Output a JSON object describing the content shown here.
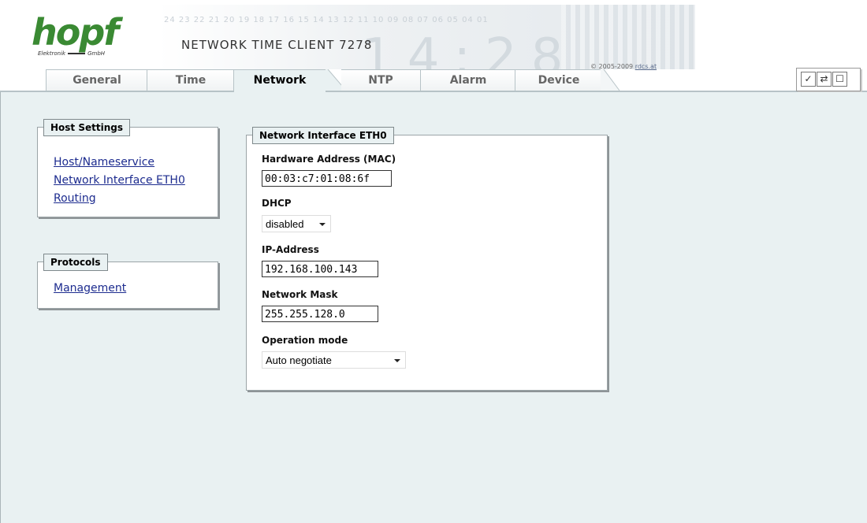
{
  "header": {
    "logo_text": "hopf",
    "logo_sub_left": "Elektronik",
    "logo_sub_right": "GmbH",
    "product_title": "NETWORK TIME CLIENT 7278",
    "banner_digits": "24 23 22 21 20 19 18 17 16 15 14 13 12 11 10 09 08 07 06 05 04 01",
    "banner_bignum": "14:28",
    "copyright_prefix": "© 2005-2009 ",
    "copyright_link": "rdcs.at"
  },
  "tabs": [
    {
      "label": "General"
    },
    {
      "label": "Time"
    },
    {
      "label": "Network"
    },
    {
      "label": "NTP"
    },
    {
      "label": "Alarm"
    },
    {
      "label": "Device"
    }
  ],
  "active_tab": "Network",
  "toolbar": {
    "apply_icon": "check-icon",
    "reload_icon": "refresh-icon",
    "save_icon": "save-icon"
  },
  "host_settings": {
    "legend": "Host Settings",
    "links": [
      "Host/Nameservice",
      "Network Interface ETH0",
      "Routing"
    ]
  },
  "protocols": {
    "legend": "Protocols",
    "links": [
      "Management"
    ]
  },
  "eth0": {
    "legend": "Network Interface ETH0",
    "mac_label": "Hardware Address (MAC)",
    "mac_value": "00:03:c7:01:08:6f",
    "dhcp_label": "DHCP",
    "dhcp_value": "disabled",
    "ip_label": "IP-Address",
    "ip_value": "192.168.100.143",
    "mask_label": "Network Mask",
    "mask_value": "255.255.128.0",
    "opmode_label": "Operation mode",
    "opmode_value": "Auto negotiate"
  },
  "colors": {
    "content_bg": "#e9f1f2",
    "link": "#1d2c8f",
    "logo_green": "#3a8a33"
  }
}
